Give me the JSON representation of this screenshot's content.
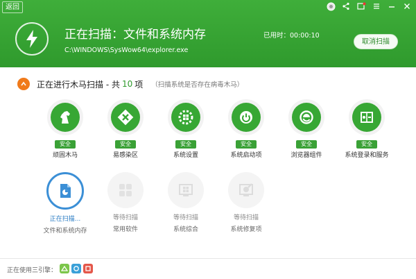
{
  "header": {
    "back_label": "返回",
    "title": "正在扫描：文件和系统内存",
    "path": "C:\\WINDOWS\\SysWow64\\explorer.exe",
    "elapsed_label": "已用时：00:00:10",
    "cancel_label": "取消扫描",
    "colors": {
      "bg": "#3aa836",
      "accent": "#2e9a2b"
    }
  },
  "section": {
    "title_prefix": "正在进行木马扫描 - 共",
    "count": "10",
    "title_suffix": "项",
    "note": "（扫描系统是否存在病毒木马）"
  },
  "items_done": [
    {
      "label": "顽固木马",
      "status": "安全",
      "icon": "horse-icon"
    },
    {
      "label": "易感染区",
      "status": "安全",
      "icon": "hazard-icon"
    },
    {
      "label": "系统设置",
      "status": "安全",
      "icon": "windows-gear-icon"
    },
    {
      "label": "系统启动项",
      "status": "安全",
      "icon": "power-icon"
    },
    {
      "label": "浏览器组件",
      "status": "安全",
      "icon": "ie-icon"
    },
    {
      "label": "系统登录和服务",
      "status": "安全",
      "icon": "login-service-icon"
    }
  ],
  "items_pending": [
    {
      "status": "正在扫描...",
      "label": "文件和系统内存",
      "icon": "memory-scan-icon"
    },
    {
      "status": "等待扫描",
      "label": "常用软件",
      "icon": "apps-icon"
    },
    {
      "status": "等待扫描",
      "label": "系统综合",
      "icon": "windows-icon"
    },
    {
      "status": "等待扫描",
      "label": "系统修复项",
      "icon": "repair-icon"
    }
  ],
  "footer": {
    "engine_label": "正在使用三引擎：",
    "engines": [
      "cloud-engine-icon",
      "qvm-engine-icon",
      "local-engine-icon"
    ]
  }
}
